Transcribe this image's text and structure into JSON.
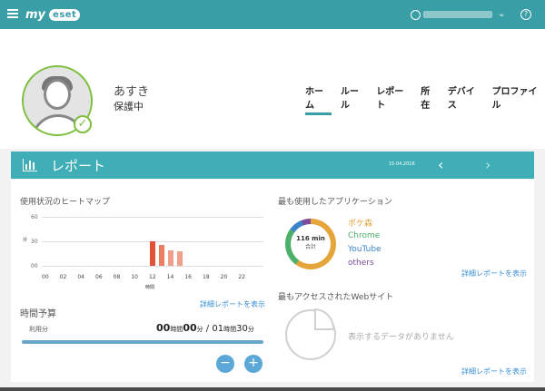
{
  "header": {
    "logo_my": "my",
    "logo_brand": "eset",
    "help_glyph": "?",
    "caret": "⌄"
  },
  "profile": {
    "name": "あすき",
    "status": "保護中",
    "check_glyph": "✓"
  },
  "tabs": [
    "ホーム",
    "ルール",
    "レポート",
    "所在",
    "デバイス",
    "プロファイル"
  ],
  "report": {
    "title": "レポート",
    "date": "15.04.2016",
    "prev": "‹",
    "next": "›"
  },
  "heatmap": {
    "title": "使用状況のヒートマップ",
    "y_label": "分",
    "x_label": "時間",
    "link": "詳細レポートを表示"
  },
  "chart_data": {
    "type": "bar",
    "title": "使用状況のヒートマップ",
    "xlabel": "時間",
    "ylabel": "分",
    "x_ticks": [
      "00",
      "02",
      "04",
      "06",
      "08",
      "10",
      "12",
      "14",
      "16",
      "18",
      "20",
      "22"
    ],
    "y_ticks": [
      "60",
      "30",
      "00"
    ],
    "ylim": [
      0,
      60
    ],
    "hours": [
      12,
      13,
      14,
      15
    ],
    "values": [
      30,
      26,
      19,
      18
    ],
    "colors": [
      "#e0533a",
      "#ea7d62",
      "#f0a08a",
      "#f0a08a"
    ],
    "grid": true
  },
  "budget": {
    "title": "時間予算",
    "used_label": "利用分",
    "used_h": "00",
    "used_m": "00",
    "total_h": "01",
    "total_m": "30",
    "hours_unit": "時間",
    "minutes_unit": "分",
    "separator": " / ",
    "minus": "−",
    "plus": "+"
  },
  "apps": {
    "title": "最も使用したアプリケーション",
    "total_value": "116 min",
    "total_label": "合計",
    "items": [
      {
        "name": "ポケ森",
        "color": "#e6a53a"
      },
      {
        "name": "Chrome",
        "color": "#4caf6a"
      },
      {
        "name": "YouTube",
        "color": "#3c84c8"
      },
      {
        "name": "others",
        "color": "#7b4c9c"
      }
    ],
    "link": "詳細レポートを表示"
  },
  "sites": {
    "title": "最もアクセスされたWebサイト",
    "empty": "表示するデータがありません",
    "link": "詳細レポートを表示"
  }
}
